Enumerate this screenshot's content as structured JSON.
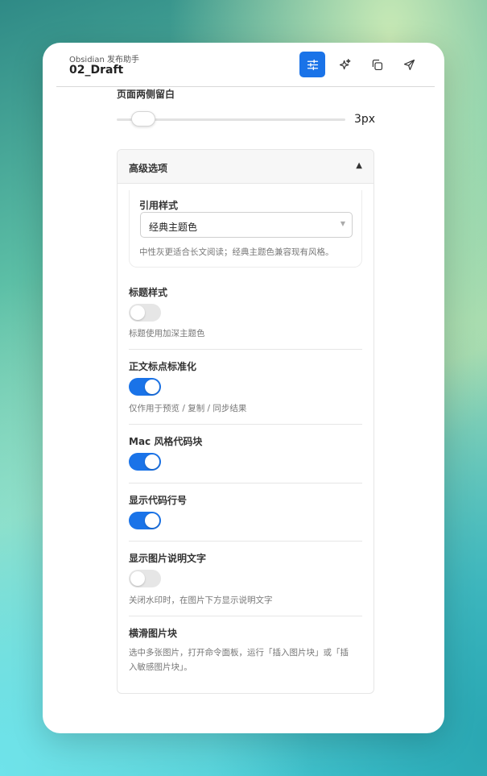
{
  "header": {
    "app_name": "Obsidian 发布助手",
    "doc_title": "02_Draft",
    "buttons": [
      "settings-icon",
      "sparkle-icon",
      "copy-icon",
      "send-icon"
    ]
  },
  "margin": {
    "label": "页面两侧留白",
    "value": "3px"
  },
  "advanced": {
    "title": "高级选项",
    "quote": {
      "label": "引用样式",
      "selected": "经典主题色",
      "hint": "中性灰更适合长文阅读；经典主题色兼容现有风格。"
    },
    "options": [
      {
        "label": "标题样式",
        "enabled": false,
        "hint": "标题使用加深主题色"
      },
      {
        "label": "正文标点标准化",
        "enabled": true,
        "hint": "仅作用于预览 / 复制 / 同步结果"
      },
      {
        "label": "Mac 风格代码块",
        "enabled": true,
        "hint": ""
      },
      {
        "label": "显示代码行号",
        "enabled": true,
        "hint": ""
      },
      {
        "label": "显示图片说明文字",
        "enabled": false,
        "hint": "关闭水印时，在图片下方显示说明文字"
      }
    ],
    "scroll_block": {
      "label": "横滑图片块",
      "hint_line1": "选中多张图片，打开命令面板，运行「插入图片块」或「插",
      "hint_line2": "入敏感图片块」。"
    }
  },
  "colors": {
    "accent": "#1a73e8"
  }
}
